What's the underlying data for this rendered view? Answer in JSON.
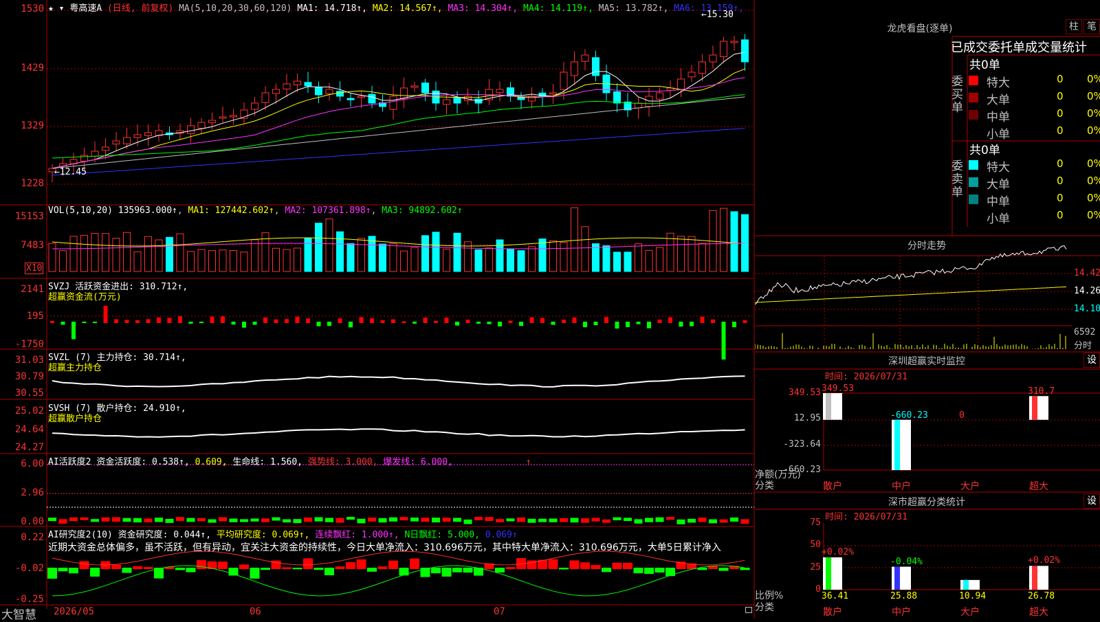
{
  "stock": {
    "name": "粤高速A",
    "mode": "(日线, 前复权)",
    "ma_label": "MA(5,10,20,30,60,120)",
    "ma": [
      {
        "label": "MA1:",
        "value": "14.718↑",
        "color": "#ffffff"
      },
      {
        "label": "MA2:",
        "value": "14.567↑",
        "color": "#ffff00"
      },
      {
        "label": "MA3:",
        "value": "14.304↑",
        "color": "#ff33ff"
      },
      {
        "label": "MA4:",
        "value": "14.119↑",
        "color": "#00ff00"
      },
      {
        "label": "MA5:",
        "value": "13.782↑",
        "color": "#c0c0c0"
      },
      {
        "label": "MA6:",
        "value": "13.159↑",
        "color": "#3333ff"
      }
    ],
    "high_mark": "15.30",
    "low_mark": "12.45",
    "price_axis": [
      "1530",
      "1429",
      "1329",
      "1228"
    ]
  },
  "volume": {
    "header": "VOL(5,10,20)",
    "value": "135963.000↑",
    "ma1": "MA1: 127442.602↑",
    "ma2": "MA2: 107361.898↑",
    "ma3": "MA3: 94892.602↑",
    "axis": [
      "15153",
      "7483"
    ],
    "unit_badge": "X10"
  },
  "svzj": {
    "name": "SVZJ",
    "text": "活跃资金进出: 310.712↑,",
    "subtitle": "超赢资金流(万元)",
    "axis": [
      "2141",
      "195",
      "-1750"
    ]
  },
  "svzl": {
    "name": "SVZL (7)",
    "text": "主力持仓: 30.714↑,",
    "subtitle": "超赢主力持仓",
    "axis": [
      "31.03",
      "30.79",
      "30.55"
    ]
  },
  "svsh": {
    "name": "SVSH (7)",
    "text": "散户持仓: 24.910↑,",
    "subtitle": "超赢散户持仓",
    "axis": [
      "25.02",
      "24.64",
      "24.27"
    ]
  },
  "ai_active": {
    "name": "AI活跃度2",
    "text1": "资金活跃度: 0.538↑,",
    "text2": "0.609,",
    "text3": "生命线: 1.560,",
    "text4": "强势线: 3.000,",
    "text5": "爆发线: 6.000,",
    "text6": "↑",
    "axis": [
      "6.00",
      "2.96",
      "0.00"
    ]
  },
  "ai_research": {
    "name": "AI研究度2(10)",
    "text1": "资金研究度: 0.044↑,",
    "text2": "平均研究度: 0.069↑,",
    "text3": "连续飘红: 1.000↑,",
    "text4": "N日飘红: 5.000,",
    "text5": "0.069↑",
    "commentary": "近期大资金总体偏多，虽不活跃，但有异动，宜关注大资金的持续性，今日大单净流入：310.696万元，其中特大单净流入：310.696万元，大单5日累计净入",
    "axis": [
      "0.22",
      "-0.02",
      "-0.25"
    ]
  },
  "bottom": {
    "brand": "大智慧",
    "dates": [
      "2026/05",
      "06",
      "07"
    ]
  },
  "right": {
    "lhb_title": "龙虎看盘(逐单)",
    "btn_bar": "柱",
    "btn_pen": "笔",
    "tabs_text": "已成交委托单成交量统计",
    "buy_side": "委买单",
    "sell_side": "委卖单",
    "buy_total": "共0单",
    "sell_total": "共0单",
    "buy_rows": [
      {
        "name": "特大",
        "val": "0",
        "pct": "0%",
        "color": "#ff0000"
      },
      {
        "name": "大单",
        "val": "0",
        "pct": "0%",
        "color": "#a00000"
      },
      {
        "name": "中单",
        "val": "0",
        "pct": "0%",
        "color": "#700000"
      },
      {
        "name": "小单",
        "val": "0",
        "pct": "0%",
        "color": "#000000"
      }
    ],
    "sell_rows": [
      {
        "name": "特大",
        "val": "0",
        "pct": "0%",
        "color": "#00ffff"
      },
      {
        "name": "大单",
        "val": "0",
        "pct": "0%",
        "color": "#00a0a0"
      },
      {
        "name": "中单",
        "val": "0",
        "pct": "0%",
        "color": "#008080"
      },
      {
        "name": "小单",
        "val": "0",
        "pct": "0%",
        "color": "#000000"
      }
    ],
    "fs_title": "分时走势",
    "fs_axis": [
      "14.42",
      "14.26",
      "14.10"
    ],
    "fs_vol": "6592",
    "fs_vol_unit": "分时",
    "monitor_title": "深圳超赢实时监控",
    "monitor_time": "时间: 2026/07/31",
    "monitor_set": "设",
    "monitor_axis": [
      "349.53",
      "12.95",
      "-323.64",
      "-660.23"
    ],
    "monitor_bar_labels": [
      "349.53",
      "-660.23",
      "0",
      "310.7"
    ],
    "monitor_ylabel": "净额(万元)",
    "monitor_xlabel": "分类",
    "classes": [
      "散户",
      "中户",
      "大户",
      "超大"
    ],
    "stat_title": "深市超赢分类统计",
    "stat_time": "时间: 2026/07/31",
    "stat_set": "设",
    "stat_axis": [
      "75",
      "50",
      "25",
      "0"
    ],
    "stat_pct": [
      "+0.02%",
      "-0.04%",
      "",
      "+0.02%"
    ],
    "stat_vals": [
      "36.41",
      "25.88",
      "10.94",
      "26.78"
    ],
    "stat_ylabel": "比例%",
    "stat_xlabel": "分类"
  },
  "chart_data": [
    {
      "type": "bar",
      "title": "深圳超赢实时监控",
      "categories": [
        "散户",
        "中户",
        "大户",
        "超大"
      ],
      "values": [
        349.53,
        -660.23,
        0,
        310.7
      ],
      "ylabel": "净额(万元)",
      "ylim": [
        -660.23,
        349.53
      ]
    },
    {
      "type": "bar",
      "title": "深市超赢分类统计",
      "categories": [
        "散户",
        "中户",
        "大户",
        "超大"
      ],
      "values": [
        36.41,
        25.88,
        10.94,
        26.78
      ],
      "ylabel": "比例%",
      "ylim": [
        0,
        75
      ]
    }
  ]
}
